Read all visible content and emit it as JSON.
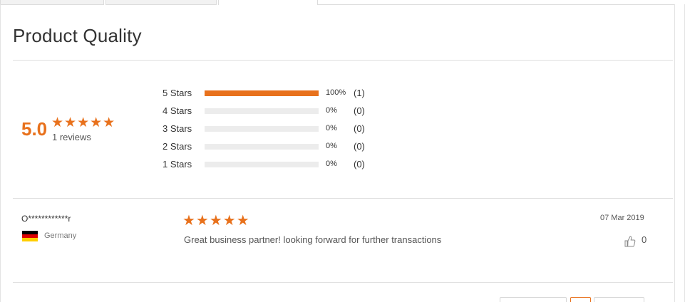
{
  "title": "Product Quality",
  "summary": {
    "average": "5.0",
    "stars": "★★★★★",
    "review_count": "1 reviews"
  },
  "distribution": [
    {
      "label": "5 Stars",
      "percent": "100%",
      "count": "(1)",
      "fill": 1.0
    },
    {
      "label": "4 Stars",
      "percent": "0%",
      "count": "(0)",
      "fill": 0
    },
    {
      "label": "3 Stars",
      "percent": "0%",
      "count": "(0)",
      "fill": 0
    },
    {
      "label": "2 Stars",
      "percent": "0%",
      "count": "(0)",
      "fill": 0
    },
    {
      "label": "1 Stars",
      "percent": "0%",
      "count": "(0)",
      "fill": 0
    }
  ],
  "review": {
    "reviewer": "O************r",
    "country": "Germany",
    "flag_icon": "germany-flag-icon",
    "stars": "★★★★★",
    "text": "Great business partner! looking forward for further transactions",
    "date": "07 Mar 2019",
    "likes": "0"
  },
  "colors": {
    "accent": "#e8711c",
    "track": "#ececec"
  }
}
